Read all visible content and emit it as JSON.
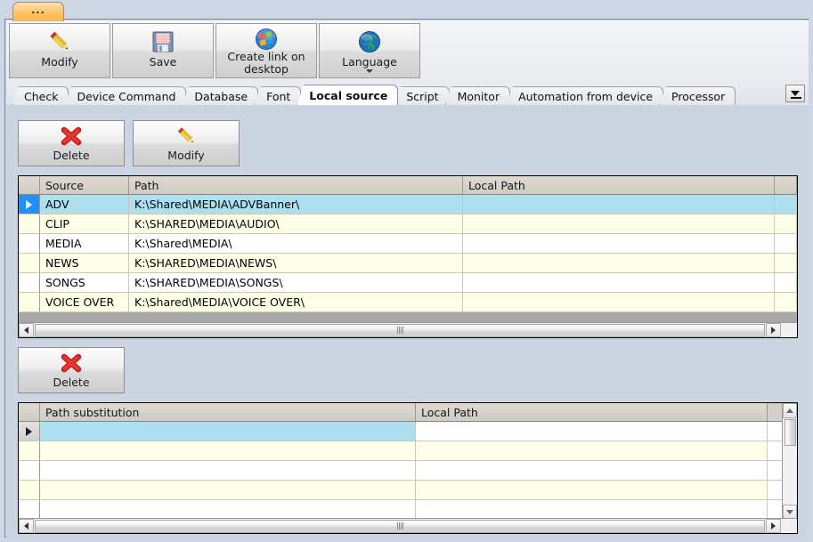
{
  "window": {
    "title_tab_label": "...",
    "title_tab_icon": "ellipsis-icon"
  },
  "ribbon": {
    "buttons": [
      {
        "label": "Modify",
        "icon": "pencil-icon",
        "has_caret": false
      },
      {
        "label": "Save",
        "icon": "floppy-disk-icon",
        "has_caret": false
      },
      {
        "label": "Create link on desktop",
        "icon": "windows-logo-icon",
        "has_caret": false
      },
      {
        "label": "Language",
        "icon": "globe-icon",
        "has_caret": true
      }
    ]
  },
  "tabs": {
    "items": [
      {
        "label": "Check",
        "active": false
      },
      {
        "label": "Device Command",
        "active": false
      },
      {
        "label": "Database",
        "active": false
      },
      {
        "label": "Font",
        "active": false
      },
      {
        "label": "Local source",
        "active": true
      },
      {
        "label": "Script",
        "active": false
      },
      {
        "label": "Monitor",
        "active": false
      },
      {
        "label": "Automation from device",
        "active": false
      },
      {
        "label": "Processor",
        "active": false
      }
    ],
    "overflow_icon": "chevron-down-icon"
  },
  "upper_panel": {
    "buttons": [
      {
        "label": "Delete",
        "icon": "red-x-icon"
      },
      {
        "label": "Modify",
        "icon": "pencil-icon"
      }
    ],
    "grid": {
      "columns": [
        "Source",
        "Path",
        "Local Path"
      ],
      "rows": [
        {
          "source": "ADV",
          "path": "K:\\Shared\\MEDIA\\ADVBanner\\",
          "local_path": "",
          "selected": true
        },
        {
          "source": "CLIP",
          "path": "K:\\SHARED\\MEDIA\\AUDIO\\",
          "local_path": "",
          "selected": false
        },
        {
          "source": "MEDIA",
          "path": "K:\\Shared\\MEDIA\\",
          "local_path": "",
          "selected": false
        },
        {
          "source": "NEWS",
          "path": "K:\\SHARED\\MEDIA\\NEWS\\",
          "local_path": "",
          "selected": false
        },
        {
          "source": "SONGS",
          "path": "K:\\SHARED\\MEDIA\\SONGS\\",
          "local_path": "",
          "selected": false
        },
        {
          "source": "VOICE OVER",
          "path": "K:\\Shared\\MEDIA\\VOICE OVER\\",
          "local_path": "",
          "selected": false
        }
      ]
    }
  },
  "lower_panel": {
    "buttons": [
      {
        "label": "Delete",
        "icon": "red-x-icon"
      }
    ],
    "grid": {
      "columns": [
        "Path substitution",
        "Local Path"
      ],
      "rows": [
        {
          "path_substitution": "",
          "local_path": "",
          "selected": true
        },
        {
          "path_substitution": "",
          "local_path": "",
          "selected": false
        },
        {
          "path_substitution": "",
          "local_path": "",
          "selected": false
        },
        {
          "path_substitution": "",
          "local_path": "",
          "selected": false
        },
        {
          "path_substitution": "",
          "local_path": "",
          "selected": false
        },
        {
          "path_substitution": "",
          "local_path": "",
          "selected": false
        }
      ]
    }
  },
  "colors": {
    "window_background": "#ccd4e2",
    "selection": "#ade0ef",
    "indicator_selected": "#1e90ff",
    "row_alt": "#fffee6",
    "header": "#d4d0c8",
    "accent_tab": "#ffc166"
  }
}
